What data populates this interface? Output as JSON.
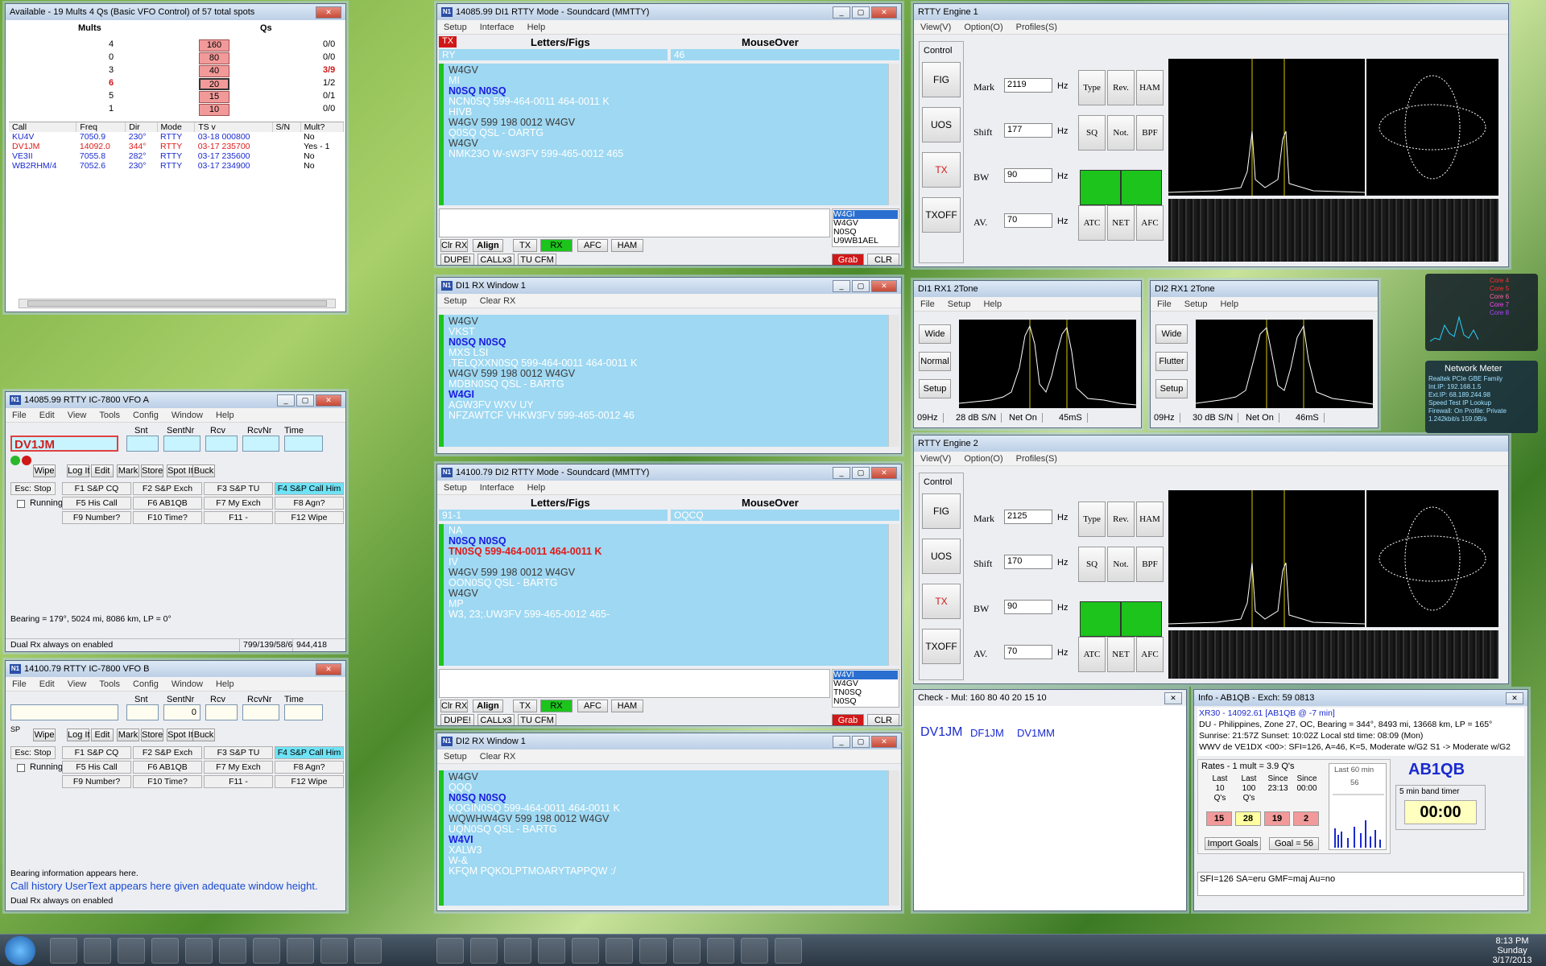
{
  "available": {
    "title": "Available - 19 Mults 4 Qs  (Basic VFO Control) of 57 total spots",
    "mults_hdr": "Mults",
    "qs_hdr": "Qs",
    "bands": [
      {
        "mults": "4",
        "band": "160",
        "qs": "0/0"
      },
      {
        "mults": "0",
        "band": "80",
        "qs": "0/0"
      },
      {
        "mults": "3",
        "band": "40",
        "qs": "3/9"
      },
      {
        "mults": "6",
        "band": "20",
        "qs": "1/2"
      },
      {
        "mults": "5",
        "band": "15",
        "qs": "0/1"
      },
      {
        "mults": "1",
        "band": "10",
        "qs": "0/0"
      }
    ],
    "cols": [
      "Call",
      "Freq",
      "Dir",
      "Mode",
      "TS v",
      "S/N",
      "Mult?"
    ],
    "rows": [
      {
        "call": "KU4V",
        "freq": "7050.9",
        "dir": "230°",
        "mode": "RTTY",
        "ts": "03-18 000800",
        "sn": "",
        "mult": "No"
      },
      {
        "call": "DV1JM",
        "freq": "14092.0",
        "dir": "344°",
        "mode": "RTTY",
        "ts": "03-17 235700",
        "sn": "",
        "mult": "Yes - 1"
      },
      {
        "call": "VE3II",
        "freq": "7055.8",
        "dir": "282°",
        "mode": "RTTY",
        "ts": "03-17 235600",
        "sn": "",
        "mult": "No"
      },
      {
        "call": "WB2RHM/4",
        "freq": "7052.6",
        "dir": "230°",
        "mode": "RTTY",
        "ts": "03-17 234900",
        "sn": "",
        "mult": "No"
      }
    ]
  },
  "vfoa": {
    "title": "14085.99 RTTY IC-7800 VFO A",
    "menu": [
      "File",
      "Edit",
      "View",
      "Tools",
      "Config",
      "Window",
      "Help"
    ],
    "fields": [
      "Snt",
      "SentNr",
      "Rcv",
      "RcvNr",
      "Time"
    ],
    "call": "DV1JM",
    "sp": "SP",
    "btns": [
      "Wipe",
      "Log It",
      "Edit",
      "Mark",
      "Store",
      "Spot It",
      "Buck"
    ],
    "esc": "Esc: Stop",
    "running": "Running",
    "fkeys": [
      "F1 S&P CQ",
      "F2 S&P Exch",
      "F3 S&P TU",
      "F4 S&P Call Him",
      "F5 His Call",
      "F6 AB1QB",
      "F7 My Exch",
      "F8 Agn?",
      "F9 Number?",
      "F10 Time?",
      "F11 -",
      "F12 Wipe"
    ],
    "bearing": "Bearing = 179°, 5024  mi, 8086 km, LP = 0°",
    "status1": "Dual Rx always on enabled",
    "status2": "799/139/58/6",
    "status3": "944,418"
  },
  "vfob": {
    "title": "14100.79 RTTY IC-7800 VFO B",
    "sentnr": "0",
    "bearing": "Bearing information appears here.",
    "usertext": "Call history UserText appears here given adequate window height.",
    "status1": "Dual Rx always on enabled"
  },
  "mmtty1": {
    "title": "14085.99  DI1 RTTY Mode - Soundcard (MMTTY)",
    "menu": [
      "Setup",
      "Interface",
      "Help"
    ],
    "tx": "TX",
    "lf": "Letters/Figs",
    "mo": "MouseOver",
    "lfv": "RY",
    "mov": "46",
    "lines": [
      {
        "t": "W4GV",
        "c": "g"
      },
      {
        "t": "MI",
        "c": ""
      },
      {
        "t": "N0SQ N0SQ",
        "c": "b"
      },
      {
        "t": "NCN0SQ 599-464-0011 464-0011 K",
        "c": ""
      },
      {
        "t": "HIVB",
        "c": ""
      },
      {
        "t": "W4GV 599 198 0012 W4GV",
        "c": "g"
      },
      {
        "t": "Q0SQ QSL - OARTG",
        "c": ""
      },
      {
        "t": "W4GV",
        "c": "g"
      },
      {
        "t": "NMK23O W-sW3FV 599-465-0012 465",
        "c": ""
      }
    ],
    "calls": [
      "W4GI",
      "W4GV",
      "N0SQ",
      "U9WB1AEL"
    ],
    "btns": [
      "Clr RX",
      "Align",
      "TX",
      "RX",
      "AFC",
      "HAM",
      "DUPE!",
      "CALLx3",
      "TU CFM",
      "Grab",
      "CLR"
    ]
  },
  "rx1": {
    "title": "DI1 RX Window 1",
    "menu": [
      "Setup",
      "Clear RX"
    ],
    "lines": [
      {
        "t": "W4GV",
        "c": "g"
      },
      {
        "t": "VKST",
        "c": ""
      },
      {
        "t": "N0SQ N0SQ",
        "c": "b"
      },
      {
        "t": "MXS LSI",
        "c": ""
      },
      {
        "t": ".TELQXXN0SQ 599-464-0011 464-0011 K",
        "c": ""
      },
      {
        "t": "W4GV 599 198 0012 W4GV",
        "c": "g"
      },
      {
        "t": "MDBN0SQ QSL - BARTG",
        "c": ""
      },
      {
        "t": "W4GI",
        "c": "b"
      },
      {
        "t": "AGW3FV WXV UY",
        "c": ""
      },
      {
        "t": "NFZAWTCF VHKW3FV 599-465-0012 46",
        "c": ""
      }
    ]
  },
  "mmtty2": {
    "title": "14100.79  DI2 RTTY Mode - Soundcard (MMTTY)",
    "lfv": "91-1",
    "mov": "OQCQ",
    "lines": [
      {
        "t": "NA",
        "c": ""
      },
      {
        "t": "N0SQ N0SQ",
        "c": "b"
      },
      {
        "t": "TN0SQ 599-464-0011 464-0011 K",
        "c": "r"
      },
      {
        "t": "IV",
        "c": ""
      },
      {
        "t": "W4GV 599 198 0012 W4GV",
        "c": "g"
      },
      {
        "t": "OON0SQ QSL - BARTG",
        "c": ""
      },
      {
        "t": "W4GV",
        "c": "g"
      },
      {
        "t": "MP",
        "c": ""
      },
      {
        "t": "W3, 23;.UW3FV 599-465-0012 465-",
        "c": ""
      }
    ],
    "calls": [
      "W4VI",
      "W4GV",
      "TN0SQ",
      "N0SQ"
    ]
  },
  "rx2": {
    "title": "DI2 RX Window 1",
    "lines": [
      {
        "t": "W4GV",
        "c": "g"
      },
      {
        "t": "QQQ",
        "c": ""
      },
      {
        "t": "N0SQ N0SQ",
        "c": "b"
      },
      {
        "t": "KQGIN0SQ 599-464-0011 464-0011 K",
        "c": ""
      },
      {
        "t": "WQWHW4GV 599 198 0012 W4GV",
        "c": "g"
      },
      {
        "t": "UQN0SQ QSL - BARTG",
        "c": ""
      },
      {
        "t": "W4VI",
        "c": "b"
      },
      {
        "t": "XALW3",
        "c": ""
      },
      {
        "t": "W-&",
        "c": ""
      },
      {
        "t": "KFQM PQKOLPTMOARYTAPPQW :/",
        "c": ""
      }
    ]
  },
  "eng1": {
    "title": "RTTY Engine 1",
    "menu": [
      "View(V)",
      "Option(O)",
      "Profiles(S)"
    ],
    "control": "Control",
    "side": [
      "FIG",
      "UOS",
      "TX",
      "TXOFF"
    ],
    "labels": [
      "Mark",
      "Shift",
      "BW",
      "AV."
    ],
    "vals": [
      "2119",
      "177",
      "90",
      "70"
    ],
    "hz": "Hz",
    "grid": [
      "Type",
      "Rev.",
      "HAM",
      "SQ",
      "Not.",
      "BPF",
      "ATC",
      "NET",
      "AFC"
    ]
  },
  "eng2": {
    "title": "RTTY Engine 2",
    "vals": [
      "2125",
      "170",
      "90",
      "70"
    ]
  },
  "tone1": {
    "title": "DI1 RX1 2Tone",
    "menu": [
      "File",
      "Setup",
      "Help"
    ],
    "btns": [
      "Wide",
      "Normal",
      "Setup"
    ],
    "status": [
      "09Hz",
      "28 dB S/N",
      "Net On",
      "45mS"
    ]
  },
  "tone2": {
    "title": "DI2 RX1 2Tone",
    "btns": [
      "Wide",
      "Flutter",
      "Setup"
    ],
    "status": [
      "09Hz",
      "30 dB S/N",
      "Net On",
      "46mS"
    ]
  },
  "check": {
    "title": "Check - Mul: 160 80 40 20 15 10",
    "main": "DV1JM",
    "alt1": "DF1JM",
    "alt2": "DV1MM"
  },
  "info": {
    "title": "Info - AB1QB - Exch: 59 0813",
    "l1": "XR30 - 14092.61 [AB1QB @ -7 min]",
    "l2": "DU - Philippines, Zone 27, OC, Bearing = 344°, 8493  mi, 13668 km, LP = 165°",
    "l3": "Sunrise: 21:57Z    Sunset: 10:02Z    Local std time: 08:09 (Mon)",
    "l4": "WWV de VE1DX <00>:   SFI=126, A=46, K=5, Moderate w/G2 S1 -> Moderate w/G2",
    "rates": "Rates - 1 mult = 3.9 Q's",
    "cols": [
      "Last\n10\nQ's",
      "Last\n100\nQ's",
      "Since\n23:13",
      "Since\n00:00"
    ],
    "vals": [
      "15",
      "28",
      "19",
      "2"
    ],
    "last60": "Last 60 min",
    "n56": "56",
    "import": "Import Goals",
    "goal": "Goal = 56",
    "call": "AB1QB",
    "timer_lbl": "5 min band timer",
    "timer": "00:00",
    "bottom": "SFI=126 SA=eru GMF=maj Au=no"
  },
  "gadget": {
    "cores": [
      "Core 4",
      "Core 5",
      "Core 6",
      "Core 7",
      "Core 8"
    ],
    "net_title": "Network Meter",
    "net_lines": [
      "Realtek PCIe GBE Family",
      "Int.IP: 192.168.1.5",
      "Ext.IP: 68.189.244.98",
      "Speed Test    IP Lookup",
      "Firewall: On   Profile: Private",
      "1.242kbit/s    159.0B/s"
    ]
  },
  "taskbar": {
    "time": "8:13 PM",
    "day": "Sunday",
    "date": "3/17/2013"
  },
  "colors": {
    "rx_bg": "#9ed8f2",
    "accent_green": "#1cc41c",
    "highlight": "#6fe2f5",
    "tx_red": "#e01a1a"
  }
}
